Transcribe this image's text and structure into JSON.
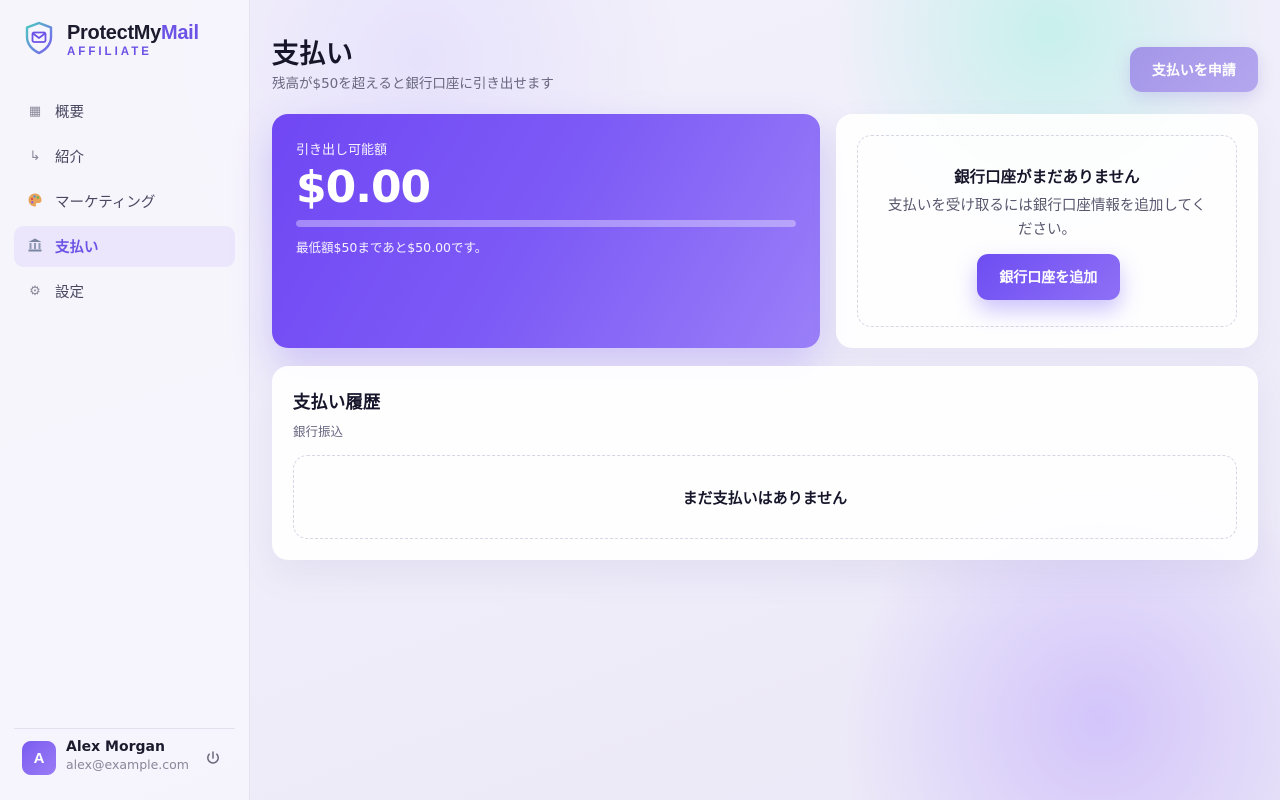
{
  "brand": {
    "name_main": "ProtectMy",
    "name_accent": "Mail",
    "subtitle": "AFFILIATE"
  },
  "nav": {
    "items": [
      {
        "label": "概要",
        "icon": "grid-icon"
      },
      {
        "label": "紹介",
        "icon": "arrow-return-icon"
      },
      {
        "label": "マーケティング",
        "icon": "palette-icon"
      },
      {
        "label": "支払い",
        "icon": "bank-icon",
        "active": true
      },
      {
        "label": "設定",
        "icon": "gear-icon"
      }
    ]
  },
  "user": {
    "initial": "A",
    "name": "Alex Morgan",
    "email": "alex@example.com"
  },
  "header": {
    "title": "支払い",
    "subtitle": "残高が$50を超えると銀行口座に引き出せます",
    "request_button": "支払いを申請"
  },
  "balance": {
    "label": "引き出し可能額",
    "amount": "$0.00",
    "progress_fraction": 0,
    "note": "最低額$50まであと$50.00です。"
  },
  "bank": {
    "title": "銀行口座がまだありません",
    "description": "支払いを受け取るには銀行口座情報を追加してください。",
    "add_button": "銀行口座を追加"
  },
  "history": {
    "title": "支払い履歴",
    "subtitle": "銀行振込",
    "empty": "まだ支払いはありません"
  },
  "colors": {
    "accent": "#6d52e6",
    "balance_gradient_start": "#7047f4",
    "balance_gradient_end": "#9a7ff8",
    "request_button": "#a496e8"
  }
}
